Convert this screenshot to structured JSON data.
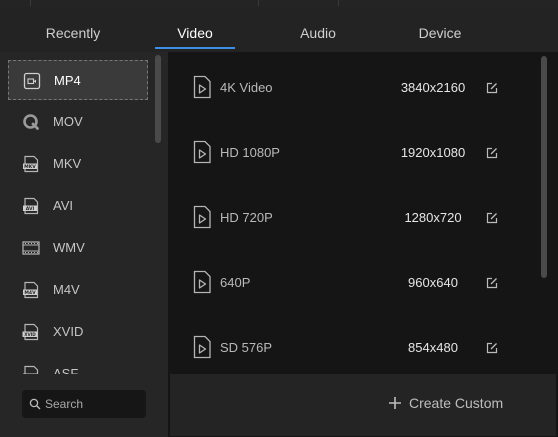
{
  "tabs": [
    {
      "label": "Recently"
    },
    {
      "label": "Video"
    },
    {
      "label": "Audio"
    },
    {
      "label": "Device"
    }
  ],
  "active_tab": "Video",
  "formats": [
    {
      "label": "MP4",
      "icon": "video-file-icon",
      "selected": true
    },
    {
      "label": "MOV",
      "icon": "quicktime-icon"
    },
    {
      "label": "MKV",
      "icon": "mkv-file-icon"
    },
    {
      "label": "AVI",
      "icon": "avi-file-icon"
    },
    {
      "label": "WMV",
      "icon": "film-strip-icon"
    },
    {
      "label": "M4V",
      "icon": "m4v-file-icon"
    },
    {
      "label": "XVID",
      "icon": "xvid-file-icon"
    },
    {
      "label": "ASF",
      "icon": "asf-file-icon"
    }
  ],
  "search": {
    "placeholder": "Search"
  },
  "presets": [
    {
      "name": "4K Video",
      "resolution": "3840x2160"
    },
    {
      "name": "HD 1080P",
      "resolution": "1920x1080"
    },
    {
      "name": "HD 720P",
      "resolution": "1280x720"
    },
    {
      "name": "640P",
      "resolution": "960x640"
    },
    {
      "name": "SD 576P",
      "resolution": "854x480"
    }
  ],
  "create_custom": {
    "label": "Create Custom"
  },
  "colors": {
    "accent": "#3d8ee6",
    "panel": "#151515",
    "sidebar": "#262626"
  }
}
